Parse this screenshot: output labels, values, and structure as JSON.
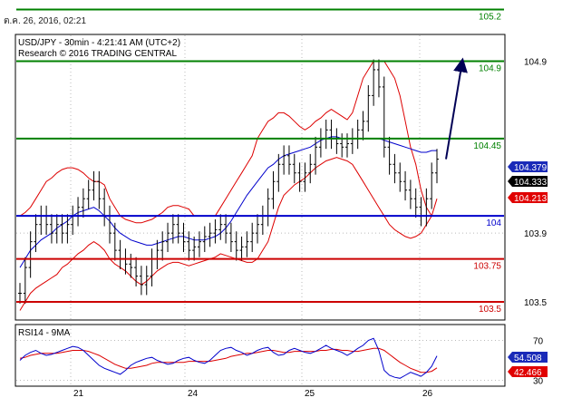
{
  "timestamp": "ต.ค. 26, 2016, 02:21",
  "chart_data": {
    "type": "candlestick",
    "title": "USD/JPY - 30min - 4:21:41 AM (UTC+2)",
    "subtitle": "Research © 2016 TRADING CENTRAL",
    "x_ticks": [
      "21",
      "24",
      "25",
      "26"
    ],
    "price_axis": {
      "ylim": [
        103.4,
        105.05
      ],
      "ticks": [
        "104.9",
        "103.9",
        "103.5"
      ],
      "tick_values": [
        104.9,
        103.9,
        103.5
      ]
    },
    "levels": [
      {
        "label": "105.2",
        "value": 105.2,
        "color": "#008000"
      },
      {
        "label": "104.9",
        "value": 104.9,
        "color": "#008000"
      },
      {
        "label": "104.45",
        "value": 104.45,
        "color": "#008000"
      },
      {
        "label": "104",
        "value": 104.0,
        "color": "#0000cc"
      },
      {
        "label": "103.75",
        "value": 103.75,
        "color": "#cc0000"
      },
      {
        "label": "103.5",
        "value": 103.5,
        "color": "#cc0000"
      }
    ],
    "price_tags": [
      {
        "label": "104.379",
        "value": 104.379,
        "bg": "#1a2ab8",
        "fg": "#ffffff"
      },
      {
        "label": "104.333",
        "value": 104.333,
        "bg": "#000000",
        "fg": "#ffffff"
      },
      {
        "label": "104.213",
        "value": 104.213,
        "bg": "#e00000",
        "fg": "#ffffff"
      }
    ],
    "arrow": {
      "from_value": 104.33,
      "to_value": 104.9,
      "color": "#000055"
    },
    "price_series": [
      103.55,
      103.7,
      103.85,
      103.95,
      104.0,
      103.95,
      103.9,
      103.95,
      103.9,
      103.95,
      104.0,
      104.05,
      104.1,
      104.15,
      104.2,
      104.1,
      104.0,
      103.9,
      103.8,
      103.75,
      103.72,
      103.7,
      103.65,
      103.6,
      103.65,
      103.75,
      103.8,
      103.85,
      103.9,
      103.95,
      103.9,
      103.85,
      103.8,
      103.82,
      103.85,
      103.88,
      103.9,
      103.92,
      103.95,
      103.9,
      103.85,
      103.8,
      103.82,
      103.85,
      103.9,
      103.95,
      104.0,
      104.1,
      104.2,
      104.3,
      104.35,
      104.3,
      104.25,
      104.2,
      104.25,
      104.3,
      104.4,
      104.45,
      104.5,
      104.45,
      104.42,
      104.4,
      104.42,
      104.45,
      104.5,
      104.55,
      104.7,
      104.85,
      104.75,
      104.4,
      104.3,
      104.25,
      104.2,
      104.15,
      104.1,
      104.05,
      104.0,
      104.1,
      104.25,
      104.33
    ],
    "bands": {
      "upper": [
        104.0,
        104.02,
        104.05,
        104.1,
        104.15,
        104.2,
        104.22,
        104.25,
        104.27,
        104.28,
        104.28,
        104.27,
        104.25,
        104.22,
        104.2,
        104.2,
        104.18,
        104.1,
        104.05,
        104.0,
        103.98,
        103.97,
        103.96,
        103.96,
        103.97,
        103.98,
        104.0,
        104.02,
        104.05,
        104.06,
        104.06,
        104.05,
        104.04,
        104.0,
        104.0,
        104.0,
        104.0,
        104.0,
        104.05,
        104.1,
        104.15,
        104.2,
        104.25,
        104.3,
        104.35,
        104.45,
        104.5,
        104.55,
        104.57,
        104.6,
        104.6,
        104.58,
        104.55,
        104.52,
        104.5,
        104.52,
        104.55,
        104.57,
        104.6,
        104.62,
        104.6,
        104.58,
        104.56,
        104.6,
        104.7,
        104.8,
        104.85,
        104.9,
        104.9,
        104.9,
        104.85,
        104.8,
        104.7,
        104.55,
        104.4,
        104.3,
        104.15,
        104.05,
        104.0,
        104.0
      ],
      "middle": [
        103.7,
        103.75,
        103.8,
        103.83,
        103.86,
        103.88,
        103.9,
        103.93,
        103.95,
        103.97,
        104.0,
        104.02,
        104.03,
        104.04,
        104.05,
        104.03,
        104.0,
        103.97,
        103.93,
        103.9,
        103.88,
        103.86,
        103.85,
        103.84,
        103.83,
        103.83,
        103.84,
        103.85,
        103.86,
        103.87,
        103.88,
        103.88,
        103.87,
        103.86,
        103.86,
        103.86,
        103.87,
        103.88,
        103.9,
        103.93,
        103.97,
        104.02,
        104.07,
        104.12,
        104.16,
        104.2,
        104.24,
        104.28,
        104.3,
        104.33,
        104.35,
        104.36,
        104.37,
        104.38,
        104.39,
        104.4,
        104.42,
        104.44,
        104.45,
        104.46,
        104.46,
        104.45,
        104.45,
        104.45,
        104.45,
        104.45,
        104.45,
        104.45,
        104.45,
        104.44,
        104.43,
        104.42,
        104.41,
        104.4,
        104.39,
        104.38,
        104.37,
        104.37,
        104.38,
        104.38
      ],
      "lower": [
        103.45,
        103.5,
        103.55,
        103.58,
        103.6,
        103.62,
        103.64,
        103.66,
        103.7,
        103.72,
        103.75,
        103.78,
        103.8,
        103.83,
        103.85,
        103.83,
        103.8,
        103.75,
        103.72,
        103.7,
        103.68,
        103.65,
        103.62,
        103.6,
        103.62,
        103.65,
        103.68,
        103.7,
        103.72,
        103.73,
        103.73,
        103.72,
        103.71,
        103.72,
        103.73,
        103.74,
        103.75,
        103.76,
        103.78,
        103.77,
        103.76,
        103.75,
        103.74,
        103.73,
        103.73,
        103.75,
        103.8,
        103.85,
        103.95,
        104.05,
        104.12,
        104.15,
        104.18,
        104.2,
        104.22,
        104.25,
        104.28,
        104.3,
        104.32,
        104.33,
        104.34,
        104.33,
        104.32,
        104.3,
        104.25,
        104.2,
        104.15,
        104.1,
        104.05,
        104.0,
        103.95,
        103.92,
        103.9,
        103.88,
        103.87,
        103.88,
        103.9,
        103.95,
        104.0,
        104.1
      ]
    },
    "rsi": {
      "label": "RSI14 - 9MA",
      "ylim": [
        25,
        85
      ],
      "ticks": [
        "70",
        "30"
      ],
      "tick_values": [
        70,
        30
      ],
      "rsi_values": [
        50,
        55,
        58,
        60,
        57,
        55,
        56,
        58,
        60,
        62,
        64,
        63,
        60,
        55,
        50,
        45,
        42,
        40,
        38,
        36,
        40,
        45,
        48,
        50,
        52,
        53,
        50,
        48,
        46,
        47,
        50,
        52,
        53,
        50,
        48,
        47,
        50,
        55,
        60,
        62,
        63,
        60,
        58,
        55,
        57,
        60,
        62,
        63,
        58,
        55,
        56,
        60,
        62,
        60,
        58,
        57,
        59,
        62,
        65,
        62,
        60,
        58,
        55,
        58,
        62,
        65,
        70,
        72,
        60,
        40,
        35,
        33,
        32,
        35,
        38,
        36,
        34,
        38,
        44,
        54.5
      ],
      "ma_values": [
        52,
        53,
        55,
        56,
        57,
        57,
        57,
        57,
        58,
        59,
        60,
        60,
        60,
        59,
        57,
        55,
        52,
        49,
        46,
        44,
        42,
        42,
        43,
        44,
        45,
        47,
        48,
        48,
        48,
        48,
        48,
        48,
        49,
        49,
        49,
        49,
        49,
        50,
        51,
        52,
        54,
        55,
        56,
        57,
        57,
        58,
        59,
        60,
        60,
        59,
        58,
        58,
        59,
        59,
        59,
        59,
        59,
        60,
        60,
        61,
        61,
        60,
        60,
        59,
        59,
        60,
        61,
        62,
        62,
        60,
        56,
        52,
        48,
        45,
        42,
        40,
        38,
        38,
        39,
        42.5
      ],
      "tags": [
        {
          "label": "54.508",
          "value": 54.5,
          "bg": "#1a2ab8",
          "fg": "#ffffff"
        },
        {
          "label": "42.466",
          "value": 42.5,
          "bg": "#e00000",
          "fg": "#ffffff"
        }
      ]
    }
  }
}
